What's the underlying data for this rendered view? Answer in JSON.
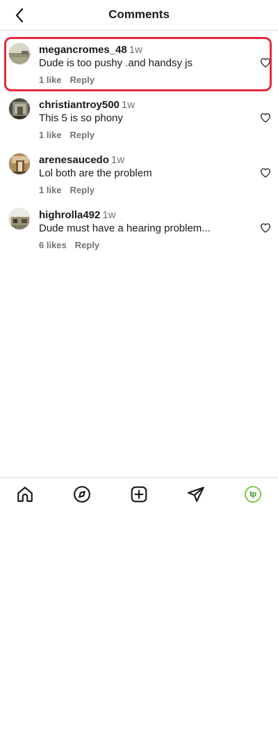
{
  "header": {
    "title": "Comments",
    "back_icon": "chevron-left-icon"
  },
  "comments": [
    {
      "username": "megancromes_48",
      "time": "1w",
      "text": "Dude is too pushy .and handsy js",
      "likes": "1 like",
      "reply": "Reply",
      "highlighted": true,
      "highlight_color": "#e8283c"
    },
    {
      "username": "christiantroy500",
      "time": "1w",
      "text": "This 5 is so phony",
      "likes": "1 like",
      "reply": "Reply"
    },
    {
      "username": "arenesaucedo",
      "time": "1w",
      "text": "Lol both are the problem",
      "likes": "1 like",
      "reply": "Reply"
    },
    {
      "username": "highrolla492",
      "time": "1w",
      "text": "Dude must have a hearing problem...",
      "likes": "6 likes",
      "reply": "Reply"
    }
  ],
  "tabbar": {
    "items": [
      {
        "icon": "home-icon"
      },
      {
        "icon": "explore-compass-icon"
      },
      {
        "icon": "create-plus-icon"
      },
      {
        "icon": "direct-send-icon"
      },
      {
        "icon": "profile-avatar-icon",
        "label": "tp",
        "accent": "#7dc74a"
      }
    ]
  },
  "colors": {
    "text_primary": "#1a1a1a",
    "text_secondary": "#737373",
    "divider": "#dbdbdb"
  }
}
